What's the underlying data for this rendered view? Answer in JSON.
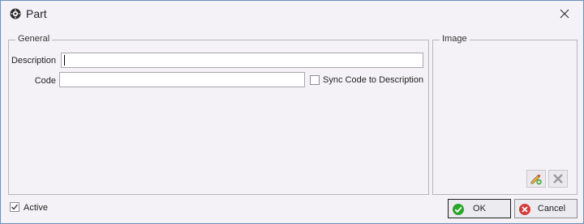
{
  "window": {
    "title": "Part"
  },
  "general": {
    "legend": "General",
    "description_label": "Description",
    "description_value": "",
    "code_label": "Code",
    "code_value": "",
    "sync_label": "Sync Code to Description",
    "sync_checked": false
  },
  "image": {
    "legend": "Image"
  },
  "footer": {
    "active_label": "Active",
    "active_checked": true,
    "ok_label": "OK",
    "cancel_label": "Cancel"
  },
  "colors": {
    "ok_icon": "#2aa52a",
    "cancel_icon": "#d43b3b",
    "window_border": "#6b8fb8"
  }
}
